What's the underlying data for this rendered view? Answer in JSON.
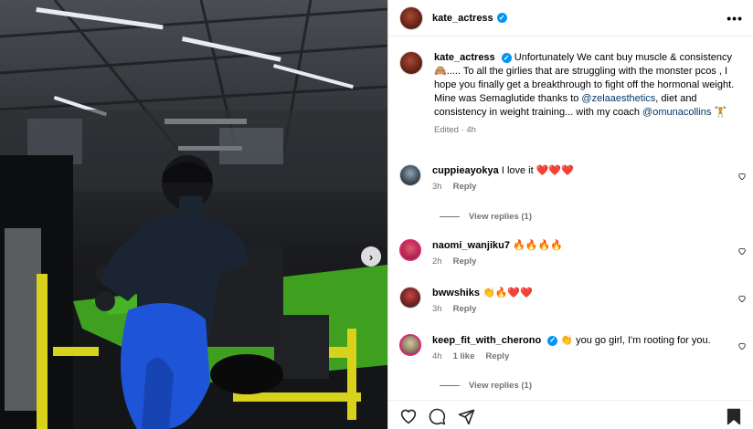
{
  "post": {
    "username": "kate_actress",
    "verified": true,
    "caption": {
      "username": "kate_actress",
      "text_1": "Unfortunately We cant buy muscle & consistency 🙈..... To all the girlies that are struggling with the monster pcos , I hope you finally get a breakthrough to fight off the hormonal weight. Mine was Semaglutide thanks to ",
      "mention_1": "@zelaaesthetics",
      "text_2": ", diet and consistency in weight training... with my coach ",
      "mention_2": "@omunacollins",
      "text_3": " 🏋",
      "meta": "Edited · 4h"
    },
    "comments": [
      {
        "username": "cuppieayokya",
        "text": "I love it ❤️❤️❤️",
        "time": "3h",
        "likes": "",
        "reply": "Reply",
        "view_replies": "View replies (1)"
      },
      {
        "username": "naomi_wanjiku7",
        "text": "🔥🔥🔥🔥",
        "time": "2h",
        "likes": "",
        "reply": "Reply",
        "view_replies": ""
      },
      {
        "username": "bwwshiks",
        "text": "👏🔥❤️❤️",
        "time": "3h",
        "likes": "",
        "reply": "Reply",
        "view_replies": ""
      },
      {
        "username": "keep_fit_with_cherono",
        "verified": true,
        "text": "👏 you go girl, I'm rooting for you.",
        "time": "4h",
        "likes": "1 like",
        "reply": "Reply",
        "view_replies": "View replies (1)"
      }
    ]
  },
  "colors": {
    "link": "#00376b",
    "meta": "#737373",
    "verified": "#0095f6",
    "heart": "#ed4956"
  },
  "icons": [
    "more-options-icon",
    "heart-icon",
    "comment-icon",
    "share-icon",
    "bookmark-icon",
    "next-arrow-icon",
    "verified-badge-icon"
  ]
}
